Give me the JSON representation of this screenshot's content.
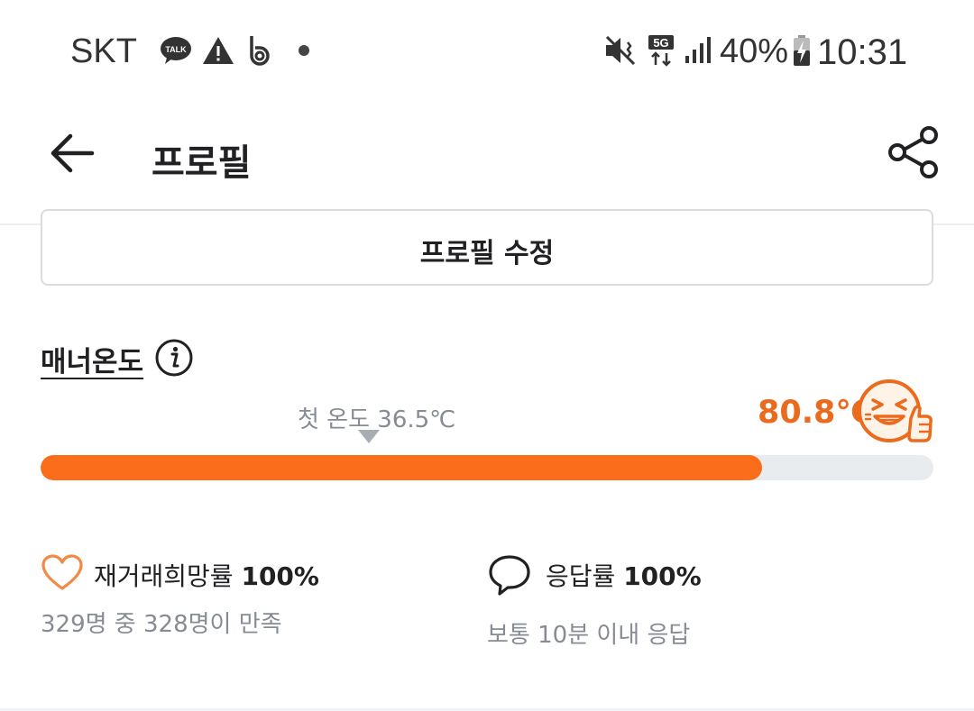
{
  "status_bar": {
    "carrier": "SKT",
    "talk_icon_text": "TALK",
    "network": "5G",
    "battery": "40%",
    "time": "10:31",
    "icons": [
      "kakaotalk-icon",
      "warning-icon",
      "b-app-icon",
      "notification-dot-icon",
      "vibrate-mute-icon",
      "5g-icon",
      "signal-icon",
      "battery-charging-icon"
    ]
  },
  "header": {
    "title": "프로필",
    "back_icon": "back-arrow-icon",
    "share_icon": "share-icon"
  },
  "profile": {
    "edit_button_label": "프로필 수정"
  },
  "manner": {
    "label": "매너온도",
    "first_temp_label": "첫 온도 36.5℃",
    "current_temp": "80.8℃",
    "first_temp_value": 36.5,
    "current_temp_value": 80.8,
    "fill_fraction": 0.808,
    "accent_color": "#fb6d1a",
    "text_color": "#eb6b1e",
    "face_icon": "laughing-thumbs-up-face-icon"
  },
  "stats": {
    "rebuy": {
      "label": "재거래희망률",
      "value": "100%",
      "sub": "329명 중 328명이 만족",
      "icon": "heart-icon"
    },
    "reply": {
      "label": "응답률",
      "value": "100%",
      "sub": "보통 10분 이내 응답",
      "icon": "chat-bubble-icon"
    }
  }
}
